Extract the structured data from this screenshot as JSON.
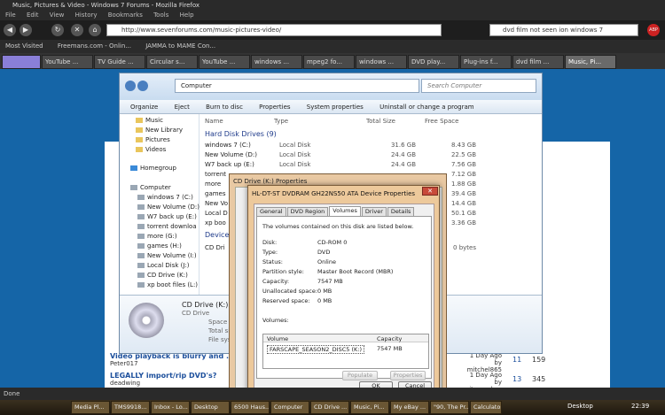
{
  "browser": {
    "title": "Music, Pictures & Video - Windows 7 Forums - Mozilla Firefox",
    "menu": [
      "File",
      "Edit",
      "View",
      "History",
      "Bookmarks",
      "Tools",
      "Help"
    ],
    "url": "http://www.sevenforums.com/music-pictures-video/",
    "search_value": "dvd film not seen ion windows 7",
    "bookmarks": [
      "Most Visited",
      "Freemans.com - Onlin...",
      "JAMMA to MAME Con..."
    ],
    "tabs": [
      "",
      "YouTube ...",
      "TV Guide ...",
      "Circular s...",
      "YouTube ...",
      "windows ...",
      "mpeg2 fo...",
      "windows ...",
      "DVD play...",
      "Plug-ins f...",
      "dvd film ...",
      "Music, Pi..."
    ],
    "status": "Done"
  },
  "forum": {
    "threads": [
      {
        "title": "Video playback is blurry and ...",
        "starter": "Peter017",
        "date": "1 Day Ago",
        "by": "by mitchel865",
        "replies": "11",
        "views": "159"
      },
      {
        "title": "LEGALLY import/rip DVD's?",
        "starter": "deadwing",
        "date": "1 Day Ago",
        "by": "by spitemonkey",
        "replies": "13",
        "views": "345"
      }
    ]
  },
  "explorer": {
    "breadcrumb": "Computer",
    "search_placeholder": "Search Computer",
    "toolbar": [
      "Organize",
      "Eject",
      "Burn to disc",
      "Properties",
      "System properties",
      "Uninstall or change a program"
    ],
    "nav": {
      "favorites": [
        "Music",
        "New Library",
        "Pictures",
        "Videos"
      ],
      "homegroup": "Homegroup",
      "computer": "Computer",
      "drives": [
        "windows 7 (C:)",
        "New Volume (D:)",
        "W7 back up (E:)",
        "torrent downloa",
        "more (G:)",
        "games (H:)",
        "New Volume (I:)",
        "Local Disk (J:)",
        "CD Drive (K:)",
        "xp boot files (L:)"
      ]
    },
    "columns": {
      "name": "Name",
      "type": "Type",
      "total": "Total Size",
      "free": "Free Space"
    },
    "hard_disk_header": "Hard Disk Drives (9)",
    "hard_disks": [
      {
        "name": "windows 7 (C:)",
        "type": "Local Disk",
        "total": "31.6 GB",
        "free": "8.43 GB"
      },
      {
        "name": "New Volume (D:)",
        "type": "Local Disk",
        "total": "24.4 GB",
        "free": "22.5 GB"
      },
      {
        "name": "W7 back up (E:)",
        "type": "Local Disk",
        "total": "24.4 GB",
        "free": "7.56 GB"
      },
      {
        "name": "torrent",
        "type": "",
        "total": "",
        "free": "7.12 GB"
      },
      {
        "name": "more",
        "type": "",
        "total": "",
        "free": "1.88 GB"
      },
      {
        "name": "games",
        "type": "",
        "total": "",
        "free": "39.4 GB"
      },
      {
        "name": "New Vo",
        "type": "",
        "total": "",
        "free": "14.4 GB"
      },
      {
        "name": "Local D",
        "type": "",
        "total": "",
        "free": "50.1 GB"
      },
      {
        "name": "xp boo",
        "type": "",
        "total": "",
        "free": "3.36 GB"
      }
    ],
    "devices_header": "Devices",
    "cd_row": {
      "name": "CD Dri",
      "free": "0 bytes"
    },
    "details": {
      "name": "CD Drive (K:)",
      "type": "CD Drive",
      "space_label": "Space fre",
      "total_label": "Total siz",
      "fs_label": "File system"
    }
  },
  "dialog_outer": {
    "title": "CD Drive (K:) Properties"
  },
  "dialog_inner": {
    "title": "HL-DT-ST DVDRAM GH22NS50 ATA Device Properties",
    "tabs": [
      "General",
      "DVD Region",
      "Volumes",
      "Driver",
      "Details"
    ],
    "description": "The volumes contained on this disk are listed below.",
    "properties": [
      {
        "k": "Disk:",
        "v": "CD-ROM 0"
      },
      {
        "k": "Type:",
        "v": "DVD"
      },
      {
        "k": "Status:",
        "v": "Online"
      },
      {
        "k": "Partition style:",
        "v": "Master Boot Record (MBR)"
      },
      {
        "k": "Capacity:",
        "v": "7547 MB"
      },
      {
        "k": "Unallocated space:",
        "v": "0 MB"
      },
      {
        "k": "Reserved space:",
        "v": "0 MB"
      }
    ],
    "volumes_label": "Volumes:",
    "volume_cols": {
      "volume": "Volume",
      "capacity": "Capacity"
    },
    "volume_row": {
      "volume": "FARSCAPE_SEASON2_DISC5 (K:)",
      "capacity": "7547 MB"
    },
    "populate": "Populate",
    "properties_btn": "Properties",
    "ok": "OK",
    "cancel": "Cancel"
  },
  "taskbar": {
    "items": [
      "Media Pl...",
      "TMS9918...",
      "Inbox - Lo...",
      "Desktop",
      "6500 Haus...",
      "Computer",
      "CD Drive ...",
      "Music, Pi...",
      "My eBay ...",
      "\"90, The Pr...",
      "Calculator"
    ],
    "desktop": "Desktop",
    "clock": "22:39"
  },
  "colors": {
    "web_bg": "#1565a7",
    "dialog_frame": "#edc99b",
    "taskbar": "#3a3020"
  }
}
